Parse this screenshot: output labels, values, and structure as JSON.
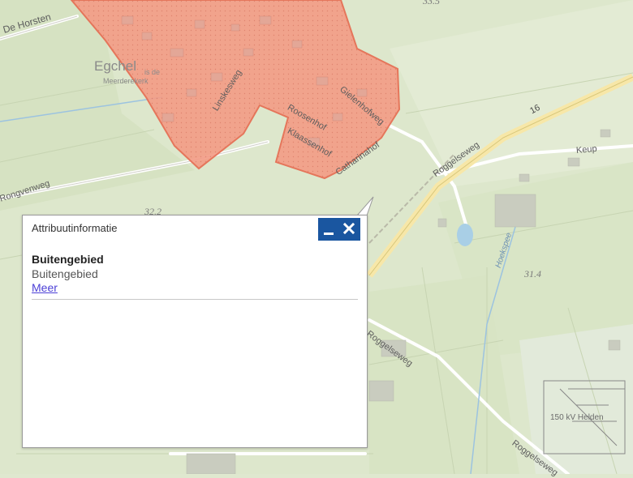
{
  "popup": {
    "title": "Attribuutinformatie",
    "minimize_icon": "minimize-icon",
    "close_icon": "close-icon",
    "attribute_name": "Buitengebied",
    "attribute_value": "Buitengebied",
    "more_link": "Meer",
    "header_button_color": "#1a56a0"
  },
  "map": {
    "town_label": "Egchel",
    "church_label": "Meerderekerk",
    "church_prefix": "is de",
    "streets": [
      "De Horsten",
      "Linskesweg",
      "Gielenhofweg",
      "Roosenhof",
      "Klaassenhof",
      "Catharinahof",
      "Rongvenweg",
      "Roggelseweg",
      "Roggelseweg",
      "Roggelseweg",
      "Keup"
    ],
    "waterway": "Hoekspee",
    "route_number": "16",
    "elevations": [
      "33.5",
      "32.2",
      "31.4"
    ],
    "facility_label": "150 kV Helden",
    "highlight_color": "#f08b75"
  }
}
